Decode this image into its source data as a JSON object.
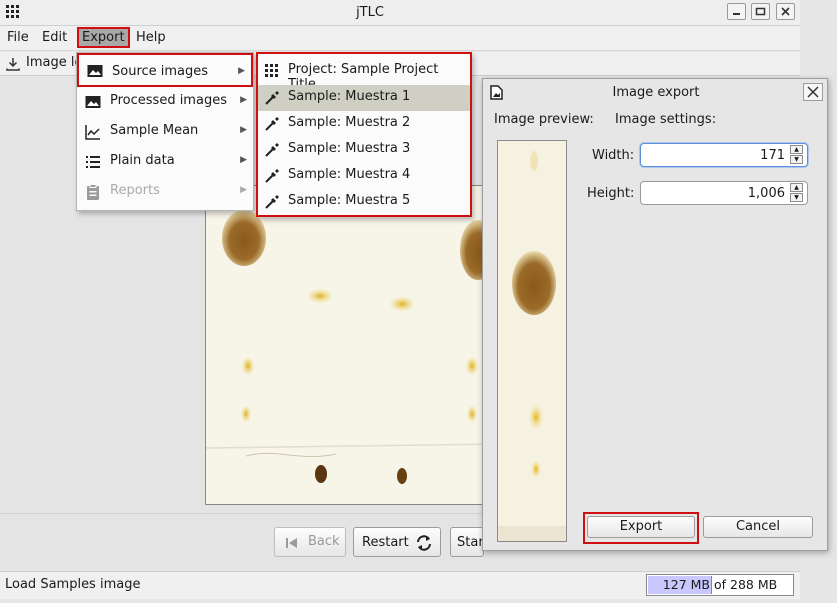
{
  "window": {
    "title": "jTLC"
  },
  "menubar": {
    "items": [
      "File",
      "Edit",
      "Export",
      "Help"
    ]
  },
  "toolbar": {
    "label": "Image lo"
  },
  "export_menu": {
    "items": [
      {
        "label": "Source images",
        "icon": "image-icon"
      },
      {
        "label": "Processed images",
        "icon": "image-icon"
      },
      {
        "label": "Sample Mean",
        "icon": "line-chart-icon"
      },
      {
        "label": "Plain data",
        "icon": "list-icon"
      },
      {
        "label": "Reports",
        "icon": "clipboard-icon",
        "disabled": true
      }
    ]
  },
  "source_submenu": {
    "items": [
      {
        "label": "Project: Sample Project Title",
        "icon": "project-grid-icon"
      },
      {
        "label": "Sample: Muestra 1",
        "icon": "pipette-icon",
        "selected": true
      },
      {
        "label": "Sample: Muestra 2",
        "icon": "pipette-icon"
      },
      {
        "label": "Sample: Muestra 3",
        "icon": "pipette-icon"
      },
      {
        "label": "Sample: Muestra 4",
        "icon": "pipette-icon"
      },
      {
        "label": "Sample: Muestra 5",
        "icon": "pipette-icon"
      }
    ]
  },
  "navigation": {
    "back_label": "Back",
    "restart_label": "Restart",
    "start_label": "Star"
  },
  "dialog": {
    "title": "Image export",
    "preview_label": "Image preview:",
    "settings_label": "Image settings:",
    "width_label": "Width:",
    "width_value": "171",
    "height_label": "Height:",
    "height_value": "1,006",
    "export_label": "Export",
    "cancel_label": "Cancel"
  },
  "status": {
    "message": "Load Samples image",
    "memory_used": "127 MB",
    "memory_of": "of 288 MB",
    "memory_fraction": 0.44
  },
  "colors": {
    "highlight_border": "#d01010",
    "menu_selection": "#cfcfc4",
    "memory_fill": "#c8c8ff"
  }
}
